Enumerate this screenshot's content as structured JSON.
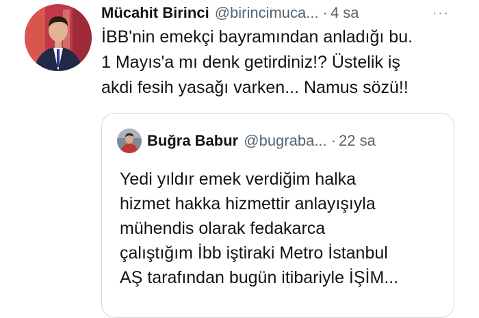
{
  "tweet": {
    "author_name": "Mücahit Birinci",
    "handle": "@birincimuca...",
    "separator": "·",
    "time": "4 sa",
    "more_label": "···",
    "text_lines": [
      "İBB'nin emekçi bayramından anladığı bu.",
      "1 Mayıs'a mı denk getirdiniz!? Üstelik iş",
      "akdi fesih yasağı varken... Namus sözü!!"
    ]
  },
  "quoted_tweet": {
    "author_name": "Buğra Babur",
    "handle": "@bugraba...",
    "separator": "·",
    "time": "22 sa",
    "text_lines": [
      "Yedi yıldır emek verdiğim halka",
      "hizmet hakka hizmettir anlayışıyla",
      "mühendis olarak fedakarca",
      "çalıştığım İbb iştiraki Metro İstanbul",
      "AŞ tarafından bugün itibariyle İŞİM..."
    ]
  },
  "colors": {
    "text_primary": "#0f1419",
    "text_secondary": "#536471",
    "border": "#cfd9de",
    "avatar_bg": "#c0394a"
  }
}
